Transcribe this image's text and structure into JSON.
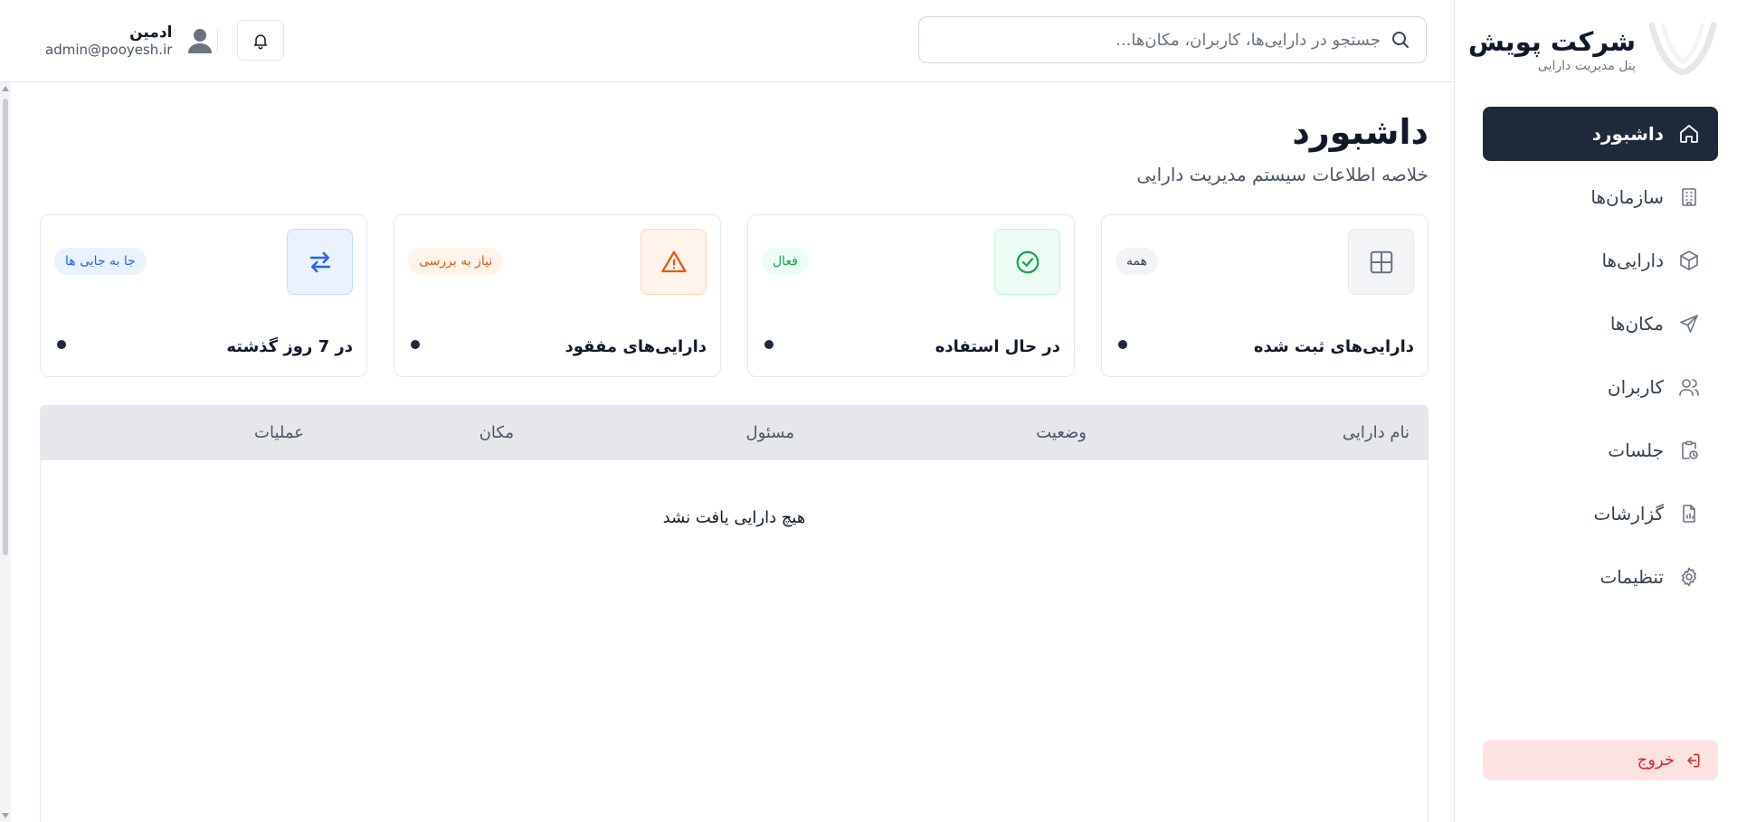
{
  "brand": {
    "title": "شرکت پویش",
    "subtitle": "پنل مدیریت دارایی"
  },
  "nav": {
    "items": [
      {
        "label": "داشبورد",
        "icon": "home-icon",
        "active": true
      },
      {
        "label": "سازمان‌ها",
        "icon": "building-icon"
      },
      {
        "label": "دارایی‌ها",
        "icon": "box-icon"
      },
      {
        "label": "مکان‌ها",
        "icon": "send-icon"
      },
      {
        "label": "کاربران",
        "icon": "users-icon"
      },
      {
        "label": "جلسات",
        "icon": "clipboard-clock-icon"
      },
      {
        "label": "گزارشات",
        "icon": "report-icon"
      },
      {
        "label": "تنظیمات",
        "icon": "gear-icon"
      }
    ],
    "logout_label": "خروج"
  },
  "header": {
    "search_placeholder": "جستجو در دارایی‌ها، کاربران، مکان‌ها...",
    "user_name": "ادمین",
    "user_email": "admin@pooyesh.ir"
  },
  "page": {
    "title": "داشبورد",
    "subtitle": "خلاصه اطلاعات سیستم مدیریت دارایی"
  },
  "cards": [
    {
      "label": "دارایی‌های ثبت شده",
      "badge": "همه",
      "icon": "grid-icon",
      "accent": "#6b7280",
      "icon_bg": "#f3f4f6",
      "badge_bg": "#f3f4f6"
    },
    {
      "label": "در حال استفاده",
      "badge": "فعال",
      "icon": "check-circle-icon",
      "accent": "#16a34a",
      "icon_bg": "#ecfdf5",
      "badge_bg": "#ecfdf5"
    },
    {
      "label": "دارایی‌های مفقود",
      "badge": "نیاز به بررسی",
      "icon": "warning-icon",
      "accent": "#ea580c",
      "icon_bg": "#fff3ea",
      "badge_bg": "#fff3ea"
    },
    {
      "label": "در 7 روز گذشته",
      "badge": "جا به جایی ها",
      "icon": "transfer-icon",
      "accent": "#2563eb",
      "icon_bg": "#eaf2ff",
      "badge_bg": "#eaf2ff"
    }
  ],
  "table": {
    "columns": [
      "نام دارایی",
      "وضعیت",
      "مسئول",
      "مکان",
      "عملیات"
    ],
    "empty_text": "هیچ دارایی یافت نشد"
  }
}
